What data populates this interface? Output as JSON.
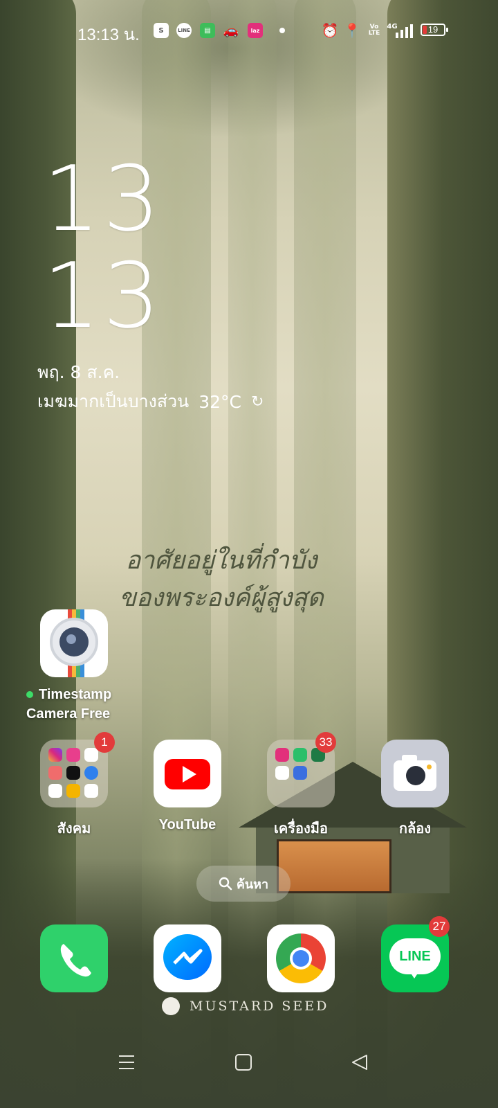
{
  "status_bar": {
    "time": "13:13 น.",
    "notification_icons": [
      "shopee-icon",
      "line-icon",
      "messages-icon",
      "car-icon",
      "lazada-icon"
    ],
    "network": "4G",
    "volte": "Vo LTE",
    "battery": "19",
    "battery_level_percent": 19
  },
  "clock": {
    "hour": "13",
    "minute": "13"
  },
  "date": "พฤ. 8 ส.ค.",
  "weather": {
    "condition": "เมฆมากเป็นบางส่วน",
    "temperature": "32°C"
  },
  "wallpaper": {
    "quote_line1": "อาศัยอยู่ในที่กำบัง",
    "quote_line2": "ของพระองค์ผู้สูงสุด",
    "brand": "MUSTARD SEED"
  },
  "widget_app": {
    "label_line1": "Timestamp",
    "label_line2": "Camera Free"
  },
  "home_row": [
    {
      "label": "สังคม",
      "badge": "1"
    },
    {
      "label": "YouTube"
    },
    {
      "label": "เครื่องมือ",
      "badge": "33"
    },
    {
      "label": "กล้อง"
    }
  ],
  "search": {
    "label": "ค้นหา"
  },
  "dock": [
    {
      "name": "phone"
    },
    {
      "name": "messenger"
    },
    {
      "name": "chrome"
    },
    {
      "name": "line",
      "label": "LINE",
      "badge": "27"
    }
  ],
  "colors": {
    "badge": "#e23b3b",
    "line_green": "#06c755",
    "phone_green": "#2fd16b",
    "youtube_red": "#ff0000"
  }
}
